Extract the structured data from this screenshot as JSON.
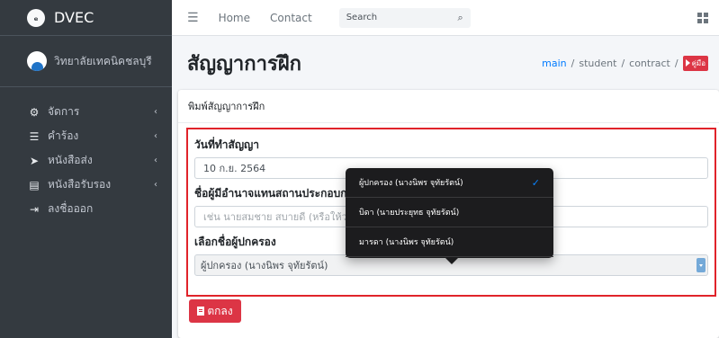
{
  "brand": {
    "name": "DVEC",
    "logo_text": "ₑ"
  },
  "user": {
    "name": "วิทยาลัยเทคนิคชลบุรี"
  },
  "sidebar": {
    "items": [
      {
        "label": "จัดการ",
        "icon": "gears-icon",
        "arrow": "‹"
      },
      {
        "label": "คำร้อง",
        "icon": "list-icon",
        "arrow": "‹"
      },
      {
        "label": "หนังสือส่ง",
        "icon": "send-icon",
        "arrow": "‹"
      },
      {
        "label": "หนังสือรับรอง",
        "icon": "certificate-icon",
        "arrow": "‹"
      },
      {
        "label": "ลงชื่อออก",
        "icon": "sign-out-icon",
        "arrow": ""
      }
    ]
  },
  "topbar": {
    "home": "Home",
    "contact": "Contact",
    "search_placeholder": "Search"
  },
  "header": {
    "title": "สัญญาการฝึก",
    "breadcrumb": {
      "link": "main",
      "items": [
        "student",
        "contract"
      ],
      "sep": "/",
      "manual": "คู่มือ"
    }
  },
  "card": {
    "title": "พิมพ์สัญญาการฝึก",
    "fields": {
      "contract_date": {
        "label": "วันที่ทำสัญญา",
        "value": "10 ก.ย. 2564"
      },
      "authority": {
        "label": "ชื่อผู้มีอำนาจแทนสถานประกอบกา",
        "placeholder": "เช่น นายสมชาย สบายดี (หรือให้ว่างไ"
      },
      "guardian": {
        "label": "เลือกชื่อผู้ปกครอง",
        "value": "ผู้ปกครอง (นางนิพร จุทัยรัตน์)"
      }
    },
    "submit": "ตกลง"
  },
  "dropdown": {
    "options": [
      {
        "label": "ผู้ปกครอง (นางนิพร จุทัยรัตน์)",
        "selected": true,
        "check": "✓"
      },
      {
        "label": "บิดา (นายประยุทธ จุทัยรัตน์)",
        "selected": false
      },
      {
        "label": "มารดา (นางนิพร จุทัยรัตน์)",
        "selected": false
      }
    ]
  }
}
